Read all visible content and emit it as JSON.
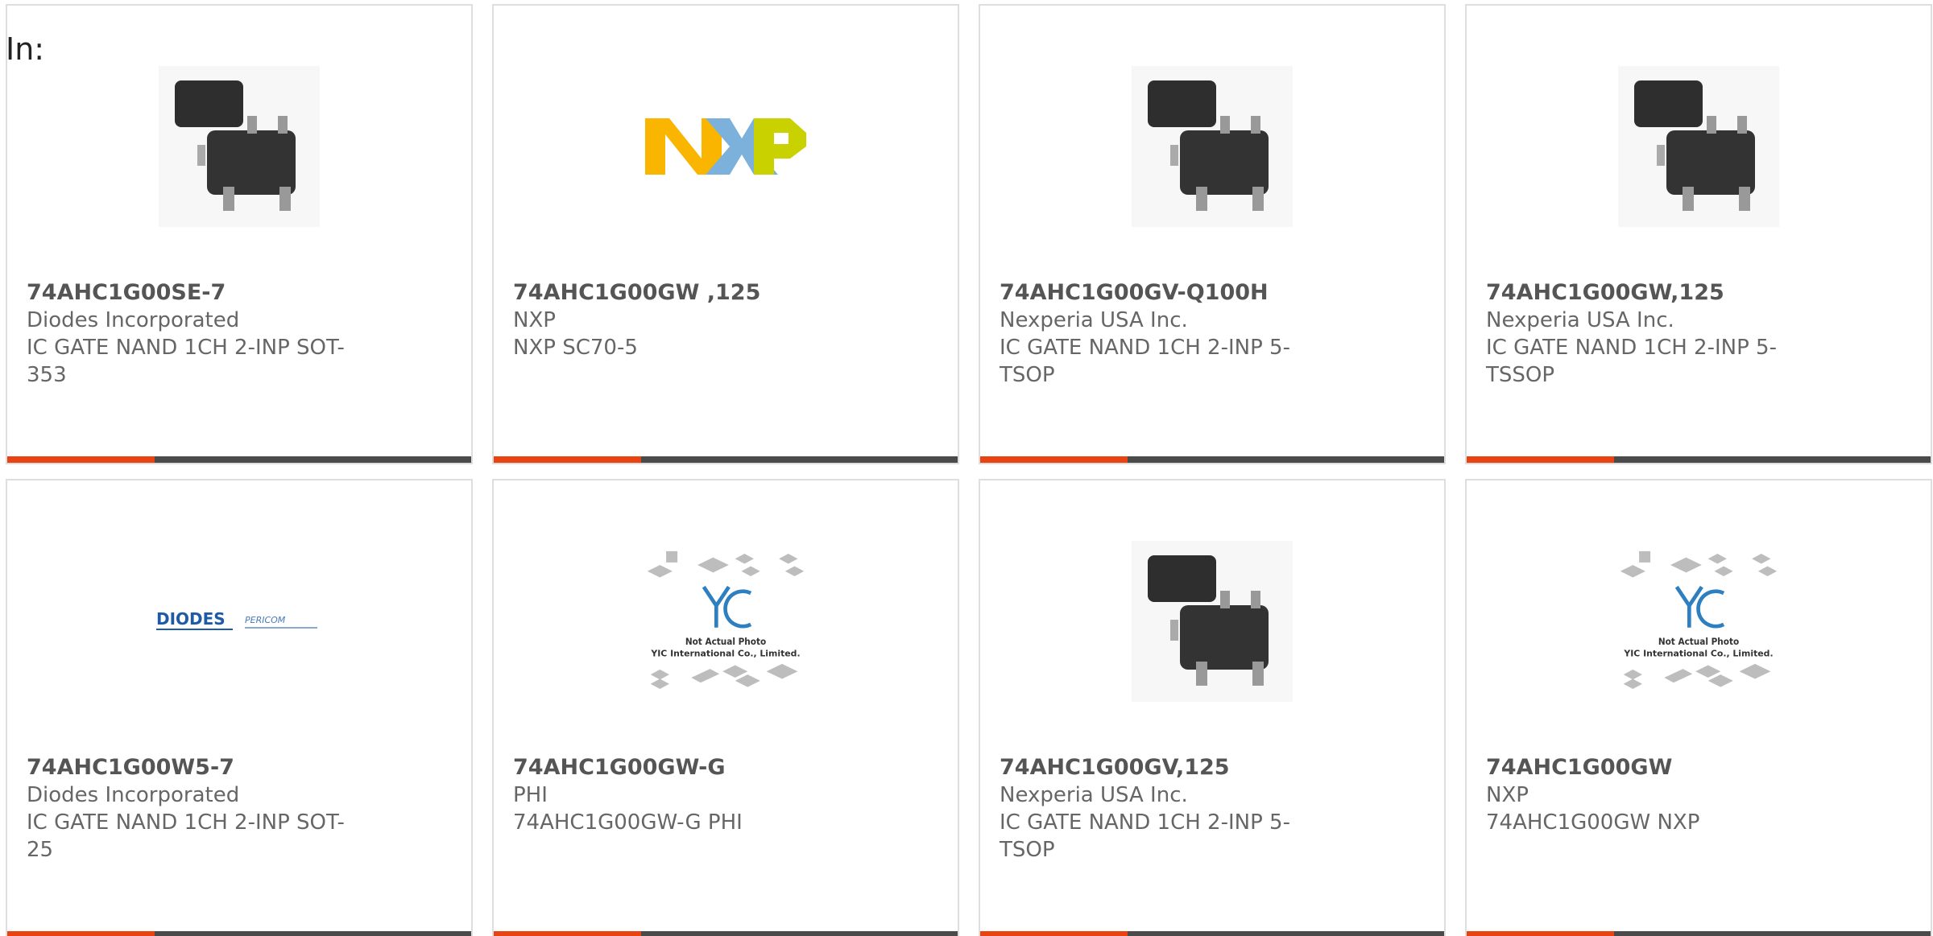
{
  "filter_label": "In:",
  "colors": {
    "accent": "#e84310",
    "bar": "#4a4a4a",
    "border": "#dedede"
  },
  "cards": [
    {
      "part_number": "74AHC1G00SE-7",
      "manufacturer": "Diodes Incorporated",
      "description": "IC GATE NAND 1CH 2-INP SOT-353",
      "image": "chip-package-icon"
    },
    {
      "part_number": "74AHC1G00GW ,125",
      "manufacturer": "NXP",
      "description": "NXP SC70-5",
      "image": "nxp-logo"
    },
    {
      "part_number": "74AHC1G00GV-Q100H",
      "manufacturer": "Nexperia USA Inc.",
      "description": "IC GATE NAND 1CH 2-INP 5-TSOP",
      "image": "chip-package-icon"
    },
    {
      "part_number": "74AHC1G00GW,125",
      "manufacturer": "Nexperia USA Inc.",
      "description": "IC GATE NAND 1CH 2-INP 5-TSSOP",
      "image": "chip-package-icon"
    },
    {
      "part_number": "74AHC1G00W5-7",
      "manufacturer": "Diodes Incorporated",
      "description": "IC GATE NAND 1CH 2-INP SOT-25",
      "image": "diodes-logo",
      "logo_text": "DIODES",
      "logo_text2": "PERICOM"
    },
    {
      "part_number": "74AHC1G00GW-G",
      "manufacturer": "PHI",
      "description": "74AHC1G00GW-G PHI",
      "image": "placeholder-photo",
      "placeholder_line1": "Not Actual Photo",
      "placeholder_line2": "YIC International Co., Limited."
    },
    {
      "part_number": "74AHC1G00GV,125",
      "manufacturer": "Nexperia USA Inc.",
      "description": "IC GATE NAND 1CH 2-INP 5-TSOP",
      "image": "chip-package-icon"
    },
    {
      "part_number": "74AHC1G00GW",
      "manufacturer": "NXP",
      "description": "74AHC1G00GW NXP",
      "image": "placeholder-photo",
      "placeholder_line1": "Not Actual Photo",
      "placeholder_line2": "YIC International Co., Limited."
    }
  ]
}
